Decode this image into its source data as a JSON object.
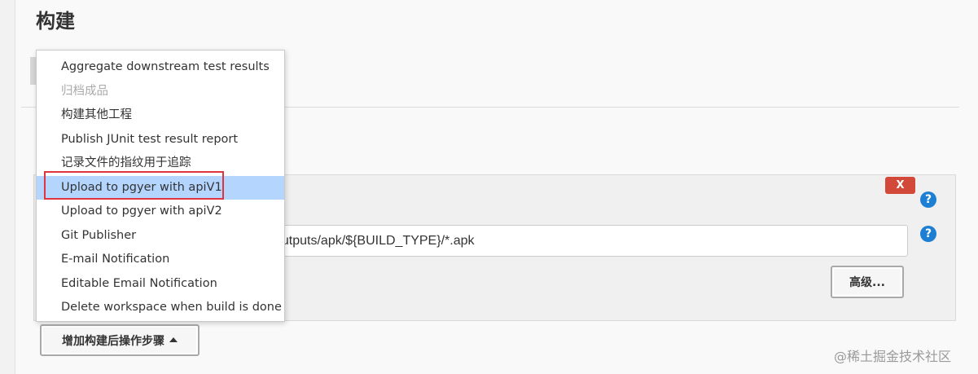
{
  "section": {
    "title": "构建"
  },
  "menu": {
    "items": [
      {
        "label": "Aggregate downstream test results",
        "state": "normal"
      },
      {
        "label": "归档成品",
        "state": "disabled"
      },
      {
        "label": "构建其他工程",
        "state": "normal"
      },
      {
        "label": "Publish JUnit test result report",
        "state": "normal"
      },
      {
        "label": "记录文件的指纹用于追踪",
        "state": "normal"
      },
      {
        "label": "Upload to pgyer with apiV1",
        "state": "selected"
      },
      {
        "label": "Upload to pgyer with apiV2",
        "state": "normal"
      },
      {
        "label": "Git Publisher",
        "state": "normal"
      },
      {
        "label": "E-mail Notification",
        "state": "normal"
      },
      {
        "label": "Editable Email Notification",
        "state": "normal"
      },
      {
        "label": "Delete workspace when build is done",
        "state": "normal"
      }
    ]
  },
  "step": {
    "delete_label": "X",
    "help_label": "?",
    "files_value": "outputs/apk/${BUILD_TYPE}/*.apk",
    "advanced_label": "高级..."
  },
  "add_step_label": "增加构建后操作步骤",
  "watermark": "@稀土掘金技术社区",
  "colors": {
    "delete": "#d24939",
    "help": "#1c7fd3",
    "selected_bg": "#b4d5fe",
    "highlight_border": "#e0353d"
  }
}
